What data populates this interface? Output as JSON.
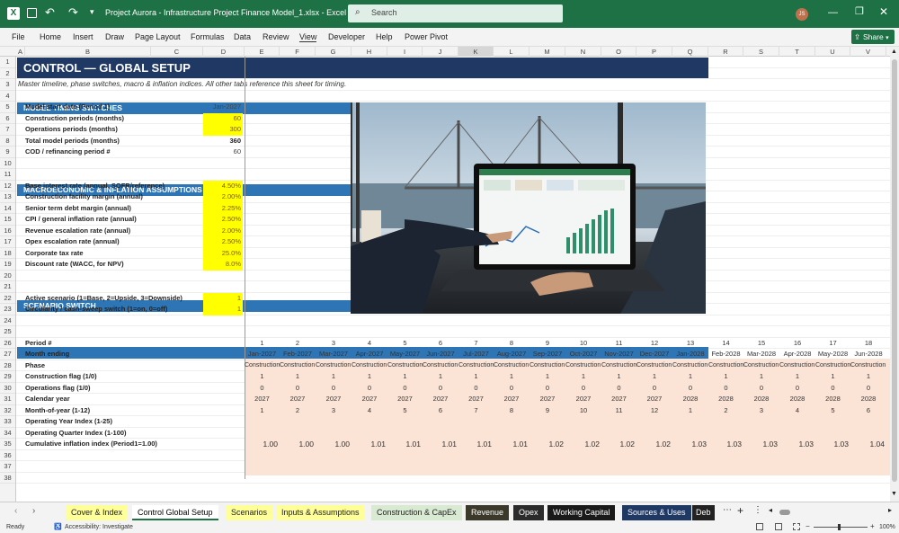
{
  "titlebar": {
    "filename": "Project Aurora - Infrastructure Project Finance Model_1.xlsx",
    "app": "Excel",
    "search_placeholder": "Search",
    "user_initials": "JS"
  },
  "menu": [
    "File",
    "Home",
    "Insert",
    "Draw",
    "Page Layout",
    "Formulas",
    "Data",
    "Review",
    "View",
    "Developer",
    "Help",
    "Power Pivot"
  ],
  "share_label": "Share",
  "columns": [
    "A",
    "B",
    "C",
    "D",
    "E",
    "F",
    "G",
    "H",
    "I",
    "J",
    "K",
    "L",
    "M",
    "N",
    "O",
    "P",
    "Q",
    "R",
    "S",
    "T",
    "U",
    "V"
  ],
  "rows": [
    "1",
    "2",
    "3",
    "4",
    "5",
    "6",
    "7",
    "8",
    "9",
    "10",
    "11",
    "12",
    "13",
    "14",
    "15",
    "16",
    "17",
    "18",
    "19",
    "20",
    "21",
    "22",
    "23",
    "24",
    "25",
    "26",
    "27",
    "28",
    "29",
    "30",
    "31",
    "32",
    "33",
    "34",
    "35",
    "36",
    "37",
    "38"
  ],
  "sheet": {
    "title": "CONTROL — GLOBAL SETUP",
    "subtitle": "Master timeline, phase switches, macro & inflation indices. All other tabs reference this sheet for timing.",
    "timing": {
      "header": "MODEL TIMING SWITCHES",
      "items": [
        {
          "label": "Model start date (Period 1)",
          "value": "Jan-2027",
          "style": "plain"
        },
        {
          "label": "Construction periods (months)",
          "value": "60",
          "style": "input"
        },
        {
          "label": "Operations periods (months)",
          "value": "300",
          "style": "input"
        },
        {
          "label": "Total model periods (months)",
          "value": "360",
          "style": "bold"
        },
        {
          "label": "COD / refinancing period #",
          "value": "60",
          "style": "plain"
        }
      ]
    },
    "macro": {
      "header": "MACROECONOMIC & INFLATION ASSUMPTIONS",
      "items": [
        {
          "label": "Base interest rate (annual, SOFR/reference)",
          "value": "4.50%"
        },
        {
          "label": "Construction facility margin (annual)",
          "value": "2.00%"
        },
        {
          "label": "Senior term debt margin (annual)",
          "value": "2.25%"
        },
        {
          "label": "CPI / general inflation rate (annual)",
          "value": "2.50%"
        },
        {
          "label": "Revenue escalation rate (annual)",
          "value": "2.00%"
        },
        {
          "label": "Opex escalation rate (annual)",
          "value": "2.50%"
        },
        {
          "label": "Corporate tax rate",
          "value": "25.0%"
        },
        {
          "label": "Discount rate (WACC, for NPV)",
          "value": "8.0%"
        }
      ]
    },
    "scenario": {
      "header": "SCENARIO SWITCH",
      "items": [
        {
          "label": "Active scenario (1=Base, 2=Upside, 3=Downside)",
          "value": "1"
        },
        {
          "label": "Circularity / cash-sweep switch (1=on, 0=off)",
          "value": "1"
        }
      ]
    },
    "timeline_labels": [
      "Period #",
      "Month ending",
      "Phase",
      "Construction flag (1/0)",
      "Operations flag (1/0)",
      "Calendar year",
      "Month-of-year (1-12)",
      "Operating Year Index (1-25)",
      "Operating Quarter Index (1-100)",
      "Cumulative inflation index (Period1=1.00)"
    ],
    "timeline": {
      "period": [
        "1",
        "2",
        "3",
        "4",
        "5",
        "6",
        "7",
        "8",
        "9",
        "10",
        "11",
        "12",
        "13",
        "14",
        "15",
        "16",
        "17",
        "18"
      ],
      "month": [
        "Jan-2027",
        "Feb-2027",
        "Mar-2027",
        "Apr-2027",
        "May-2027",
        "Jun-2027",
        "Jul-2027",
        "Aug-2027",
        "Sep-2027",
        "Oct-2027",
        "Nov-2027",
        "Dec-2027",
        "Jan-2028",
        "Feb-2028",
        "Mar-2028",
        "Apr-2028",
        "May-2028",
        "Jun-2028"
      ],
      "phase": [
        "Construction",
        "Construction",
        "Construction",
        "Construction",
        "Construction",
        "Construction",
        "Construction",
        "Construction",
        "Construction",
        "Construction",
        "Construction",
        "Construction",
        "Construction",
        "Construction",
        "Construction",
        "Construction",
        "Construction",
        "Construction"
      ],
      "constr_flag": [
        "1",
        "1",
        "1",
        "1",
        "1",
        "1",
        "1",
        "1",
        "1",
        "1",
        "1",
        "1",
        "1",
        "1",
        "1",
        "1",
        "1",
        "1"
      ],
      "ops_flag": [
        "0",
        "0",
        "0",
        "0",
        "0",
        "0",
        "0",
        "0",
        "0",
        "0",
        "0",
        "0",
        "0",
        "0",
        "0",
        "0",
        "0",
        "0"
      ],
      "year": [
        "2027",
        "2027",
        "2027",
        "2027",
        "2027",
        "2027",
        "2027",
        "2027",
        "2027",
        "2027",
        "2027",
        "2027",
        "2028",
        "2028",
        "2028",
        "2028",
        "2028",
        "2028"
      ],
      "moy": [
        "1",
        "2",
        "3",
        "4",
        "5",
        "6",
        "7",
        "8",
        "9",
        "10",
        "11",
        "12",
        "1",
        "2",
        "3",
        "4",
        "5",
        "6"
      ],
      "infl": [
        "1.00",
        "1.00",
        "1.00",
        "1.01",
        "1.01",
        "1.01",
        "1.01",
        "1.01",
        "1.02",
        "1.02",
        "1.02",
        "1.02",
        "1.03",
        "1.03",
        "1.03",
        "1.03",
        "1.03",
        "1.04"
      ]
    }
  },
  "tabs": [
    "Cover & Index",
    "Control Global Setup",
    "Scenarios",
    "Inputs & Assumptions",
    "Construction & CapEx",
    "Revenue",
    "Opex",
    "Working Capital",
    "Sources & Uses",
    "Deb"
  ],
  "status": {
    "ready": "Ready",
    "accessibility": "Accessibility: Investigate",
    "zoom": "100%"
  },
  "colors": {
    "excel_green": "#1e7145",
    "navy_title": "#1f3864",
    "section_blue": "#2e75b6",
    "input_yellow": "#ffff00",
    "timeline_peach": "#fbe3d6"
  }
}
